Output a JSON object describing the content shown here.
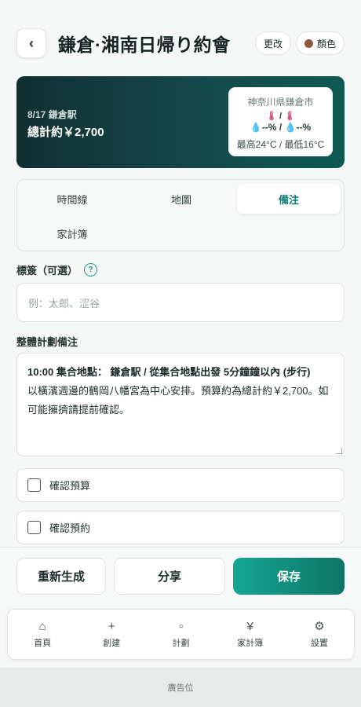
{
  "header": {
    "back_icon": "‹",
    "title": "鎌倉·湘南日帰り約會",
    "edit_label": "更改",
    "color_label": "顏色",
    "color_swatch": "#8b5a3c"
  },
  "hero": {
    "date_station": "8/17 鎌倉駅",
    "total": "總計約￥2,700",
    "weather": {
      "place": "神奈川県鎌倉市",
      "icon_sep": "/",
      "rain_a": "--%",
      "rain_sep": "/",
      "rain_b": "--%",
      "temps": "最高24°C / 最低16°C"
    }
  },
  "tabs": [
    {
      "label": "時間線"
    },
    {
      "label": "地圖"
    },
    {
      "label": "備注"
    },
    {
      "label": "家計簿"
    }
  ],
  "tags": {
    "label": "標簽（可選）",
    "help": "?",
    "placeholder": "例：太郎、涩谷"
  },
  "notes": {
    "label": "整體計劃備注",
    "line1_time": "10:00",
    "line1_text": " 集合地點： 鎌倉駅 / 從集合地點出發 5分鐘鐘以內 (步行)",
    "line2": "以橫濱週邊的鶴岡八幡宮為中心安排。預算約為總計約￥2,700。如可能擁擠請提前確認。"
  },
  "checks": [
    {
      "label": "確認預算"
    },
    {
      "label": "確認預約"
    }
  ],
  "actions": {
    "regenerate": "重新生成",
    "share": "分享",
    "save": "保存"
  },
  "nav": [
    {
      "icon": "⌂",
      "label": "首頁"
    },
    {
      "icon": "+",
      "label": "創建"
    },
    {
      "icon": "▫",
      "label": "計劃"
    },
    {
      "icon": "¥",
      "label": "家計簿"
    },
    {
      "icon": "⚙",
      "label": "設置"
    }
  ],
  "ad": "廣告位"
}
